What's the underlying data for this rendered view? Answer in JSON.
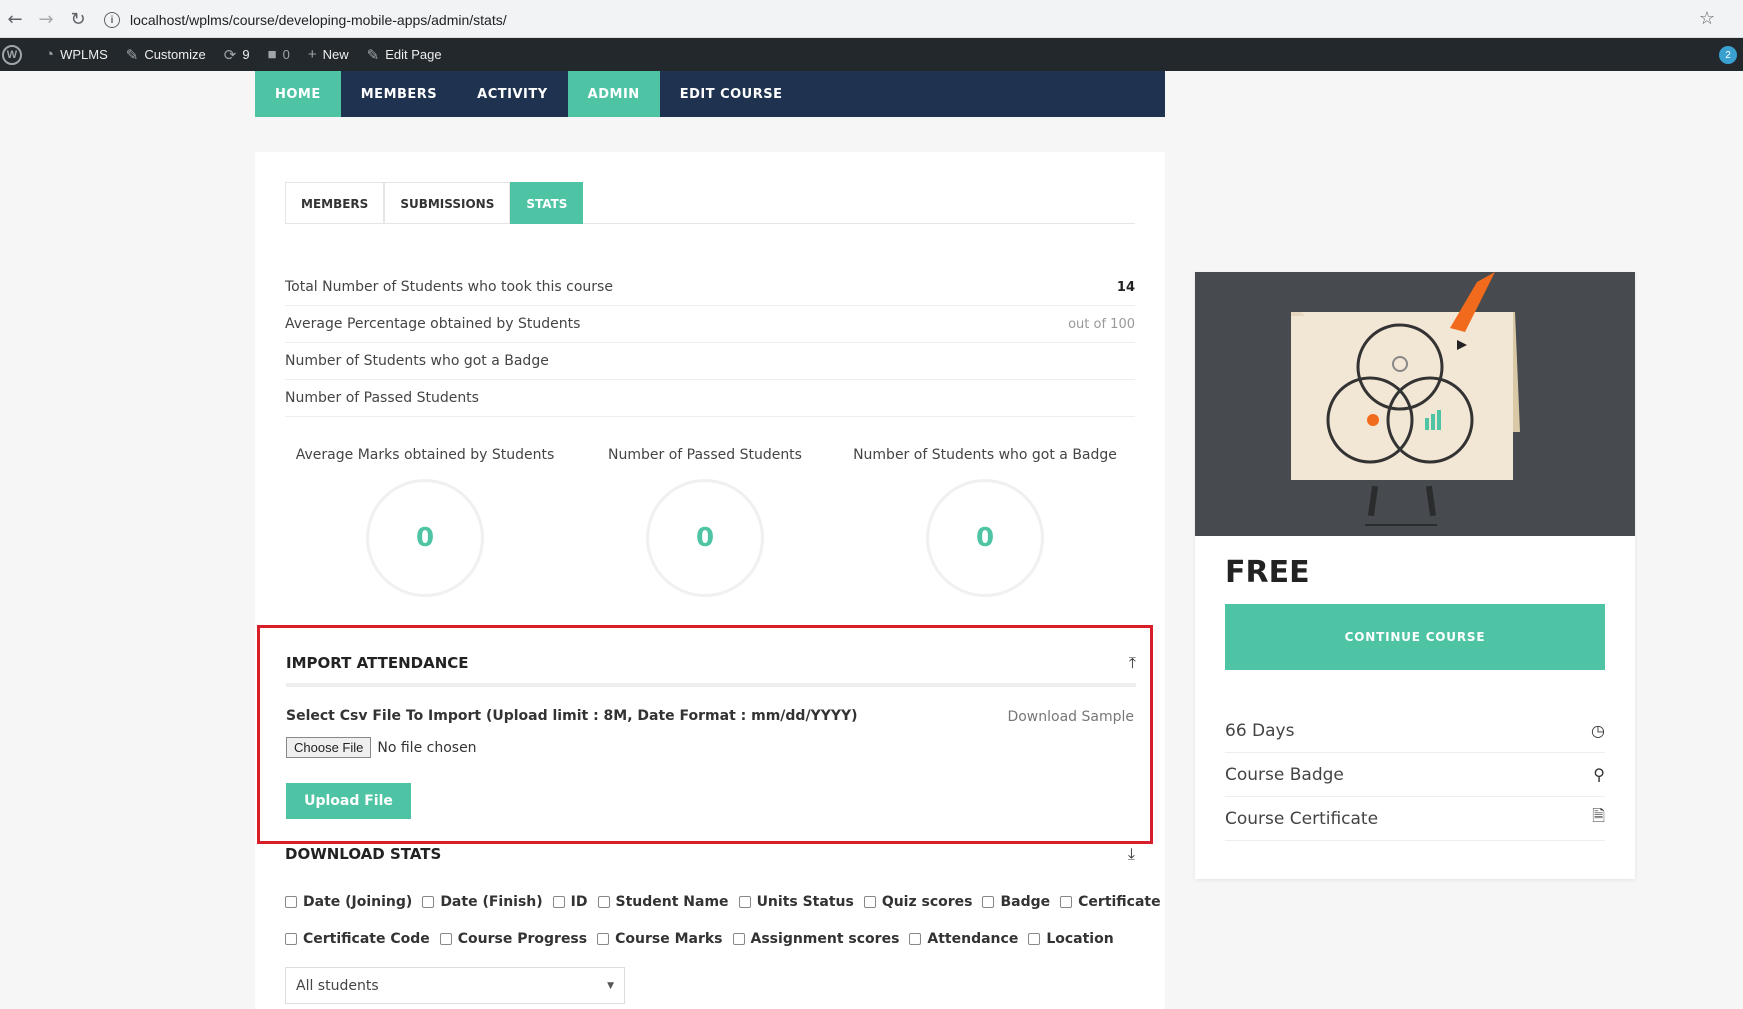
{
  "browser": {
    "url": "localhost/wplms/course/developing-mobile-apps/admin/stats/"
  },
  "wp_bar": {
    "site": "WPLMS",
    "customize": "Customize",
    "updates": "9",
    "comments": "0",
    "new": "New",
    "edit_page": "Edit Page",
    "avatar_count": "2"
  },
  "course_nav": {
    "tabs": [
      {
        "label": "HOME",
        "active": true
      },
      {
        "label": "MEMBERS",
        "active": false
      },
      {
        "label": "ACTIVITY",
        "active": false
      },
      {
        "label": "ADMIN",
        "active": true
      },
      {
        "label": "EDIT COURSE",
        "active": false
      }
    ]
  },
  "sub_tabs": [
    {
      "label": "MEMBERS"
    },
    {
      "label": "SUBMISSIONS"
    },
    {
      "label": "STATS"
    }
  ],
  "stats": [
    {
      "label": "Total Number of Students who took this course",
      "value": "14"
    },
    {
      "label": "Average Percentage obtained by Students",
      "value": "out of 100"
    },
    {
      "label": "Number of Students who got a Badge",
      "value": ""
    },
    {
      "label": "Number of Passed Students",
      "value": ""
    }
  ],
  "circles": [
    {
      "label": "Average Marks obtained by Students",
      "value": "0"
    },
    {
      "label": "Number of Passed Students",
      "value": "0"
    },
    {
      "label": "Number of Students who got a Badge",
      "value": "0"
    }
  ],
  "import": {
    "title": "IMPORT ATTENDANCE",
    "label": "Select Csv File To Import (Upload limit : 8M, Date Format : mm/dd/YYYY)",
    "download_sample": "Download Sample",
    "choose_file": "Choose File",
    "no_file": "No file chosen",
    "upload": "Upload File"
  },
  "download": {
    "title": "DOWNLOAD STATS",
    "row1": [
      "Date (Joining)",
      "Date (Finish)",
      "ID",
      "Student Name",
      "Units Status",
      "Quiz scores",
      "Badge",
      "Certificate"
    ],
    "row2": [
      "Certificate Code",
      "Course Progress",
      "Course Marks",
      "Assignment scores",
      "Attendance",
      "Location"
    ],
    "select_value": "All students"
  },
  "sidebar": {
    "price": "FREE",
    "continue": "CONTINUE COURSE",
    "rows": [
      {
        "label": "66 Days",
        "icon": "clock-icon"
      },
      {
        "label": "Course Badge",
        "icon": "badge-icon"
      },
      {
        "label": "Course Certificate",
        "icon": "certificate-icon"
      }
    ]
  },
  "colors": {
    "accent": "#4ec4a5",
    "nav": "#1f3350",
    "highlight_border": "#d81e28"
  }
}
